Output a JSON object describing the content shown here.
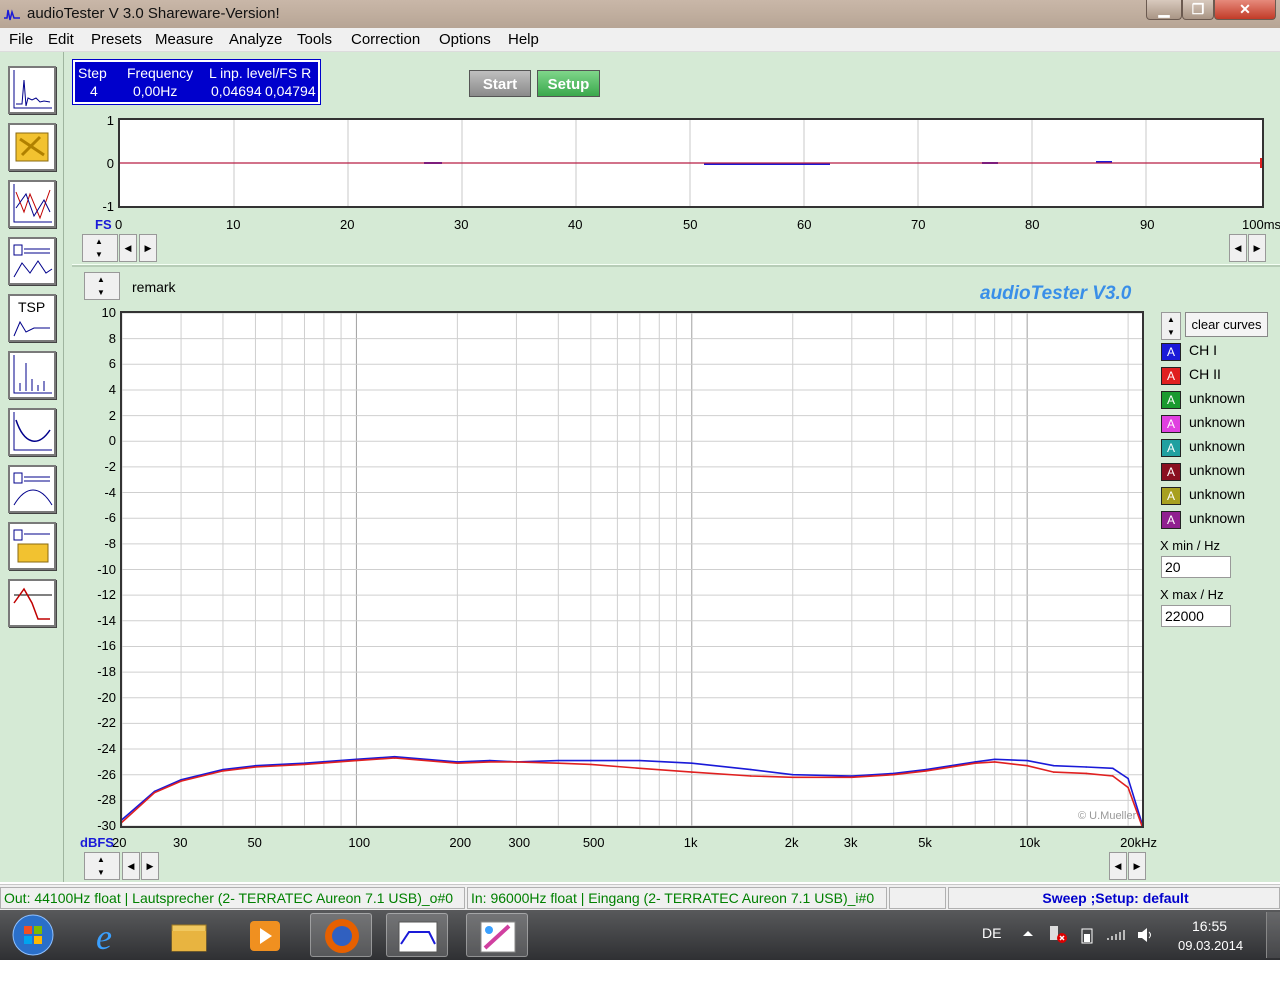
{
  "window": {
    "title": "audioTester  V 3.0 Shareware-Version!",
    "min_icon": "minimize-icon",
    "max_icon": "maximize-icon",
    "close_icon": "close-icon",
    "close_glyph": "✕",
    "min_glyph": "▁",
    "max_glyph": "❐"
  },
  "menu": [
    "File",
    "Edit",
    "Presets",
    "Measure",
    "Analyze",
    "Tools",
    "Correction",
    "Options",
    "Help"
  ],
  "toolbar": [
    "oscilloscope-icon",
    "scan-icon",
    "frequency-response-icon",
    "speaker-response-icon",
    "tsp-icon",
    "spectrum-icon",
    "impedance-icon",
    "speaker-curve-icon",
    "speaker-scan-icon",
    "step-icon"
  ],
  "readout": {
    "col_step": "Step",
    "col_frequency": "Frequency",
    "col_level": "L  inp. level/FS  R",
    "step": "4",
    "frequency": "0,00Hz",
    "left_level": "0,04694",
    "right_level": "0,04794"
  },
  "buttons": {
    "start": "Start",
    "setup": "Setup",
    "clear_curves": "clear curves"
  },
  "scope": {
    "y_ticks": [
      "1",
      "0",
      "-1"
    ],
    "x_ticks": [
      "0",
      "10",
      "20",
      "30",
      "40",
      "50",
      "60",
      "70",
      "80",
      "90",
      "100ms"
    ],
    "fs_label": "FS"
  },
  "remark": "remark",
  "brand": "audioTester  V3.0",
  "plot": {
    "y_ticks": [
      "10",
      "8",
      "6",
      "4",
      "2",
      "0",
      "-2",
      "-4",
      "-6",
      "-8",
      "-10",
      "-12",
      "-14",
      "-16",
      "-18",
      "-20",
      "-22",
      "-24",
      "-26",
      "-28",
      "-30"
    ],
    "y_unit": "dBFS",
    "x_ticks": [
      "20",
      "30",
      "50",
      "100",
      "200",
      "300",
      "500",
      "1k",
      "2k",
      "3k",
      "5k",
      "10k",
      "20kHz"
    ],
    "watermark": "© U.Mueller"
  },
  "legend": [
    {
      "label": "CH I",
      "color": "#1a1ad8"
    },
    {
      "label": "CH II",
      "color": "#e02020"
    },
    {
      "label": "unknown",
      "color": "#1a9a30"
    },
    {
      "label": "unknown",
      "color": "#e040e0"
    },
    {
      "label": "unknown",
      "color": "#20a0a0"
    },
    {
      "label": "unknown",
      "color": "#8a1020"
    },
    {
      "label": "unknown",
      "color": "#a8a020"
    },
    {
      "label": "unknown",
      "color": "#902090"
    }
  ],
  "xmin": {
    "label": "X min / Hz",
    "value": "20"
  },
  "xmax": {
    "label": "X max / Hz",
    "value": "22000"
  },
  "status": {
    "out": "Out: 44100Hz float  | Lautsprecher (2- TERRATEC Aureon 7.1 USB)_o#0",
    "in": "In: 96000Hz float  | Eingang (2- TERRATEC Aureon 7.1 USB)_i#0",
    "mode": "Sweep ;Setup: default"
  },
  "taskbar": {
    "apps": [
      "windows-start-icon",
      "internet-explorer-icon",
      "file-explorer-icon",
      "media-player-icon",
      "firefox-icon",
      "audiotester-icon",
      "paint-icon"
    ],
    "lang": "DE",
    "time": "16:55",
    "date": "09.03.2014"
  },
  "chart_data": {
    "type": "line",
    "title": "",
    "xlabel": "",
    "ylabel": "dBFS",
    "x_scale": "log",
    "xlim": [
      20,
      22000
    ],
    "ylim": [
      -30,
      10
    ],
    "grid": true,
    "series": [
      {
        "name": "CH I",
        "color": "#1a1ad8",
        "x": [
          20,
          25,
          30,
          40,
          50,
          70,
          100,
          130,
          200,
          250,
          300,
          400,
          500,
          700,
          1000,
          1500,
          2000,
          3000,
          4000,
          5000,
          7000,
          8000,
          10000,
          12000,
          15000,
          18000,
          20000,
          22000
        ],
        "y": [
          -29.5,
          -27.3,
          -26.4,
          -25.6,
          -25.3,
          -25.1,
          -24.8,
          -24.6,
          -25.0,
          -24.9,
          -25.0,
          -24.9,
          -24.9,
          -24.9,
          -25.1,
          -25.6,
          -26.0,
          -26.1,
          -25.9,
          -25.6,
          -25.0,
          -24.8,
          -24.9,
          -25.3,
          -25.4,
          -25.5,
          -26.3,
          -29.8
        ]
      },
      {
        "name": "CH II",
        "color": "#e02020",
        "x": [
          20,
          25,
          30,
          40,
          50,
          70,
          100,
          130,
          200,
          250,
          300,
          400,
          500,
          700,
          1000,
          1500,
          2000,
          3000,
          4000,
          5000,
          7000,
          8000,
          10000,
          12000,
          15000,
          18000,
          20000,
          22000
        ],
        "y": [
          -29.7,
          -27.4,
          -26.5,
          -25.7,
          -25.4,
          -25.2,
          -24.9,
          -24.7,
          -25.1,
          -25.0,
          -25.0,
          -25.1,
          -25.2,
          -25.5,
          -25.8,
          -26.1,
          -26.2,
          -26.2,
          -26.0,
          -25.7,
          -25.1,
          -25.0,
          -25.3,
          -25.8,
          -25.9,
          -26.1,
          -27.0,
          -30.0
        ]
      }
    ]
  }
}
